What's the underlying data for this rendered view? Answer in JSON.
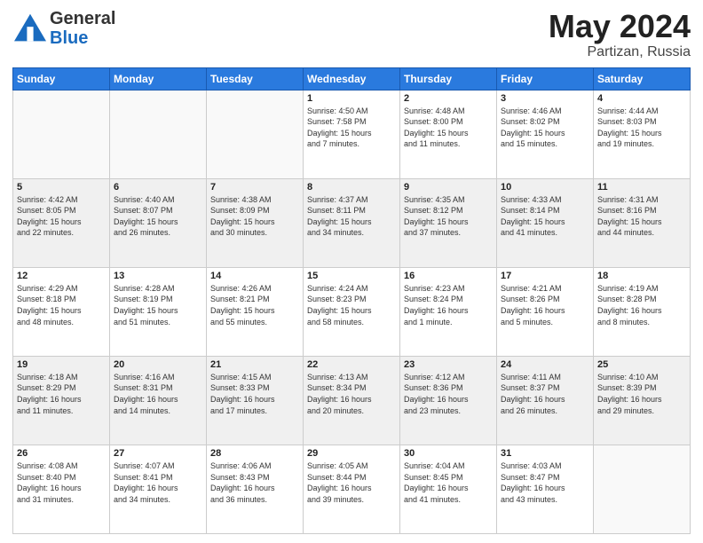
{
  "header": {
    "logo_general": "General",
    "logo_blue": "Blue",
    "month": "May 2024",
    "location": "Partizan, Russia"
  },
  "days": [
    "Sunday",
    "Monday",
    "Tuesday",
    "Wednesday",
    "Thursday",
    "Friday",
    "Saturday"
  ],
  "weeks": [
    [
      {
        "day": "",
        "info": ""
      },
      {
        "day": "",
        "info": ""
      },
      {
        "day": "",
        "info": ""
      },
      {
        "day": "1",
        "info": "Sunrise: 4:50 AM\nSunset: 7:58 PM\nDaylight: 15 hours\nand 7 minutes."
      },
      {
        "day": "2",
        "info": "Sunrise: 4:48 AM\nSunset: 8:00 PM\nDaylight: 15 hours\nand 11 minutes."
      },
      {
        "day": "3",
        "info": "Sunrise: 4:46 AM\nSunset: 8:02 PM\nDaylight: 15 hours\nand 15 minutes."
      },
      {
        "day": "4",
        "info": "Sunrise: 4:44 AM\nSunset: 8:03 PM\nDaylight: 15 hours\nand 19 minutes."
      }
    ],
    [
      {
        "day": "5",
        "info": "Sunrise: 4:42 AM\nSunset: 8:05 PM\nDaylight: 15 hours\nand 22 minutes."
      },
      {
        "day": "6",
        "info": "Sunrise: 4:40 AM\nSunset: 8:07 PM\nDaylight: 15 hours\nand 26 minutes."
      },
      {
        "day": "7",
        "info": "Sunrise: 4:38 AM\nSunset: 8:09 PM\nDaylight: 15 hours\nand 30 minutes."
      },
      {
        "day": "8",
        "info": "Sunrise: 4:37 AM\nSunset: 8:11 PM\nDaylight: 15 hours\nand 34 minutes."
      },
      {
        "day": "9",
        "info": "Sunrise: 4:35 AM\nSunset: 8:12 PM\nDaylight: 15 hours\nand 37 minutes."
      },
      {
        "day": "10",
        "info": "Sunrise: 4:33 AM\nSunset: 8:14 PM\nDaylight: 15 hours\nand 41 minutes."
      },
      {
        "day": "11",
        "info": "Sunrise: 4:31 AM\nSunset: 8:16 PM\nDaylight: 15 hours\nand 44 minutes."
      }
    ],
    [
      {
        "day": "12",
        "info": "Sunrise: 4:29 AM\nSunset: 8:18 PM\nDaylight: 15 hours\nand 48 minutes."
      },
      {
        "day": "13",
        "info": "Sunrise: 4:28 AM\nSunset: 8:19 PM\nDaylight: 15 hours\nand 51 minutes."
      },
      {
        "day": "14",
        "info": "Sunrise: 4:26 AM\nSunset: 8:21 PM\nDaylight: 15 hours\nand 55 minutes."
      },
      {
        "day": "15",
        "info": "Sunrise: 4:24 AM\nSunset: 8:23 PM\nDaylight: 15 hours\nand 58 minutes."
      },
      {
        "day": "16",
        "info": "Sunrise: 4:23 AM\nSunset: 8:24 PM\nDaylight: 16 hours\nand 1 minute."
      },
      {
        "day": "17",
        "info": "Sunrise: 4:21 AM\nSunset: 8:26 PM\nDaylight: 16 hours\nand 5 minutes."
      },
      {
        "day": "18",
        "info": "Sunrise: 4:19 AM\nSunset: 8:28 PM\nDaylight: 16 hours\nand 8 minutes."
      }
    ],
    [
      {
        "day": "19",
        "info": "Sunrise: 4:18 AM\nSunset: 8:29 PM\nDaylight: 16 hours\nand 11 minutes."
      },
      {
        "day": "20",
        "info": "Sunrise: 4:16 AM\nSunset: 8:31 PM\nDaylight: 16 hours\nand 14 minutes."
      },
      {
        "day": "21",
        "info": "Sunrise: 4:15 AM\nSunset: 8:33 PM\nDaylight: 16 hours\nand 17 minutes."
      },
      {
        "day": "22",
        "info": "Sunrise: 4:13 AM\nSunset: 8:34 PM\nDaylight: 16 hours\nand 20 minutes."
      },
      {
        "day": "23",
        "info": "Sunrise: 4:12 AM\nSunset: 8:36 PM\nDaylight: 16 hours\nand 23 minutes."
      },
      {
        "day": "24",
        "info": "Sunrise: 4:11 AM\nSunset: 8:37 PM\nDaylight: 16 hours\nand 26 minutes."
      },
      {
        "day": "25",
        "info": "Sunrise: 4:10 AM\nSunset: 8:39 PM\nDaylight: 16 hours\nand 29 minutes."
      }
    ],
    [
      {
        "day": "26",
        "info": "Sunrise: 4:08 AM\nSunset: 8:40 PM\nDaylight: 16 hours\nand 31 minutes."
      },
      {
        "day": "27",
        "info": "Sunrise: 4:07 AM\nSunset: 8:41 PM\nDaylight: 16 hours\nand 34 minutes."
      },
      {
        "day": "28",
        "info": "Sunrise: 4:06 AM\nSunset: 8:43 PM\nDaylight: 16 hours\nand 36 minutes."
      },
      {
        "day": "29",
        "info": "Sunrise: 4:05 AM\nSunset: 8:44 PM\nDaylight: 16 hours\nand 39 minutes."
      },
      {
        "day": "30",
        "info": "Sunrise: 4:04 AM\nSunset: 8:45 PM\nDaylight: 16 hours\nand 41 minutes."
      },
      {
        "day": "31",
        "info": "Sunrise: 4:03 AM\nSunset: 8:47 PM\nDaylight: 16 hours\nand 43 minutes."
      },
      {
        "day": "",
        "info": ""
      }
    ]
  ],
  "gray_rows": [
    1,
    3
  ],
  "colors": {
    "header_bg": "#2a7ade",
    "header_text": "#ffffff",
    "cell_border": "#cccccc",
    "gray_row_bg": "#f0f0f0",
    "white_row_bg": "#ffffff"
  }
}
